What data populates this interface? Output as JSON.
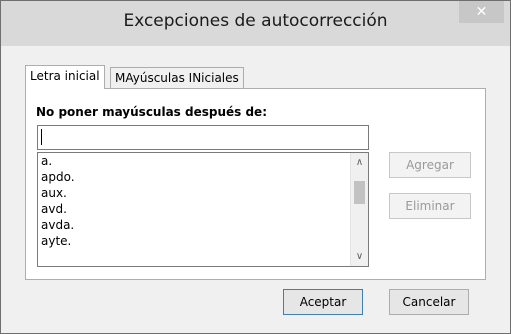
{
  "window": {
    "title": "Excepciones de autocorrección",
    "close_glyph": "✕"
  },
  "tabs": [
    {
      "label": "Letra inicial",
      "active": true
    },
    {
      "label": "MAyúsculas INiciales",
      "active": false
    }
  ],
  "panel": {
    "label": "No poner mayúsculas después de:",
    "input_value": "",
    "list_items": [
      "a.",
      "apdo.",
      "aux.",
      "avd.",
      "avda.",
      "ayte."
    ],
    "scroll_up_glyph": "∧",
    "scroll_down_glyph": "∨"
  },
  "buttons": {
    "add": "Agregar",
    "delete": "Eliminar",
    "ok": "Aceptar",
    "cancel": "Cancelar"
  },
  "icons": {
    "close": "close-icon",
    "scroll_up": "chevron-up-icon",
    "scroll_down": "chevron-down-icon"
  },
  "colors": {
    "titlebar": "#d9d9d9",
    "dialog_bg": "#f0f0f0",
    "default_button_border": "#3c7fb1"
  }
}
